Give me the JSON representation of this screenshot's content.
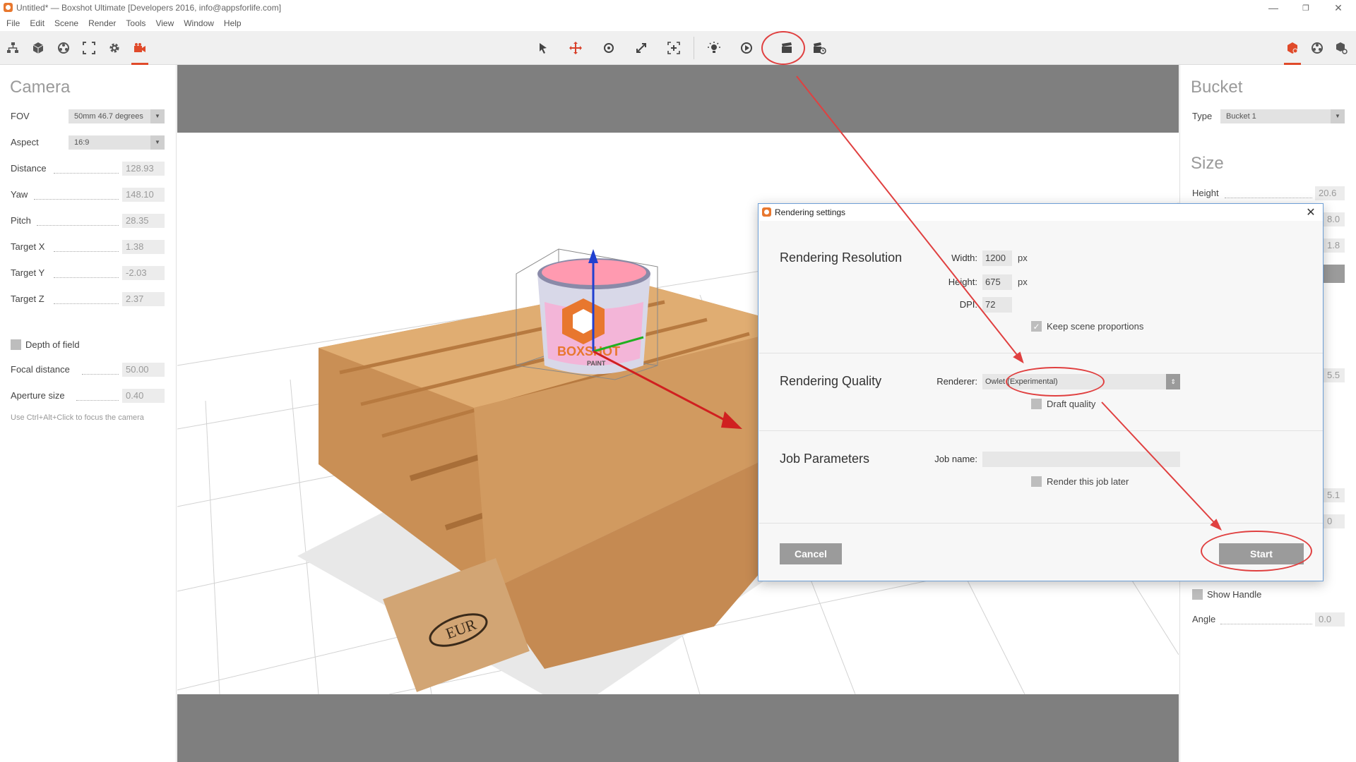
{
  "window": {
    "title": "Untitled* — Boxshot Ultimate [Developers 2016, info@appsforlife.com]",
    "minimize": "—",
    "restore": "❐",
    "close": "✕"
  },
  "menu": [
    "File",
    "Edit",
    "Scene",
    "Render",
    "Tools",
    "View",
    "Window",
    "Help"
  ],
  "toolbar": {
    "left_icons": [
      "scene-tree-icon",
      "cube-icon",
      "materials-icon",
      "frame-icon",
      "settings-gear-icon",
      "camera-icon"
    ],
    "center_icons": [
      "select-arrow-icon",
      "move-icon",
      "rotate-icon",
      "scale-icon",
      "fit-icon",
      "light-icon",
      "turntable-icon",
      "render-clapper-icon",
      "batch-render-icon"
    ],
    "right_icons": [
      "object-props-icon",
      "material-props-icon",
      "render-queue-icon"
    ]
  },
  "camera_panel": {
    "title": "Camera",
    "fov_label": "FOV",
    "fov_value": "50mm 46.7 degrees",
    "aspect_label": "Aspect",
    "aspect_value": "16:9",
    "props": [
      {
        "label": "Distance",
        "value": "128.93"
      },
      {
        "label": "Yaw",
        "value": "148.10"
      },
      {
        "label": "Pitch",
        "value": "28.35"
      },
      {
        "label": "Target X",
        "value": "1.38"
      },
      {
        "label": "Target Y",
        "value": "-2.03"
      },
      {
        "label": "Target Z",
        "value": "2.37"
      }
    ],
    "dof_label": "Depth of field",
    "focal_label": "Focal distance",
    "focal_value": "50.00",
    "aperture_label": "Aperture size",
    "aperture_value": "0.40",
    "hint": "Use Ctrl+Alt+Click to focus the camera"
  },
  "bucket_panel": {
    "title": "Bucket",
    "type_label": "Type",
    "type_value": "Bucket 1",
    "size_title": "Size",
    "height_label": "Height",
    "height_value": "20.6",
    "partial_values": [
      "8.0",
      "1.8",
      "5.5",
      "5.1",
      "0"
    ],
    "show_handle_label": "Show Handle",
    "angle_label": "Angle",
    "angle_value": "0.0"
  },
  "scene": {
    "bucket_brand": "BOXSHOT",
    "bucket_sub": "PAINT",
    "pallet_stamp": "EUR"
  },
  "dialog": {
    "title": "Rendering settings",
    "close": "✕",
    "resolution": {
      "title": "Rendering Resolution",
      "width_label": "Width:",
      "width_value": "1200",
      "height_label": "Height:",
      "height_value": "675",
      "dpi_label": "DPI:",
      "dpi_value": "72",
      "unit": "px",
      "keep_label": "Keep scene proportions",
      "keep_checked": true
    },
    "quality": {
      "title": "Rendering Quality",
      "renderer_label": "Renderer:",
      "renderer_value": "Owlet (Experimental)",
      "draft_label": "Draft quality",
      "draft_checked": false
    },
    "job": {
      "title": "Job Parameters",
      "name_label": "Job name:",
      "name_value": "",
      "later_label": "Render this job later",
      "later_checked": false
    },
    "cancel_label": "Cancel",
    "start_label": "Start"
  },
  "colors": {
    "accent": "#e8772e",
    "annotation_red": "#e04040",
    "button_gray": "#9b9b9b",
    "viewport_gray": "#7f7f7f",
    "dialog_border": "#6e9fd6"
  }
}
